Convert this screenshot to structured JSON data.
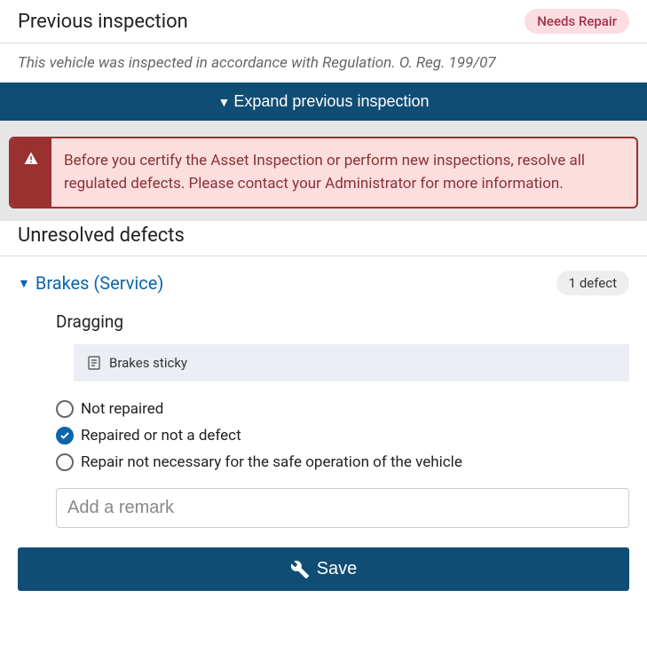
{
  "previous_inspection": {
    "title": "Previous inspection",
    "status_badge": "Needs Repair",
    "compliance_statement": "This vehicle was inspected in accordance with Regulation. O. Reg. 199/07",
    "expand_label": "Expand previous inspection"
  },
  "alert": {
    "message": "Before you certify the Asset Inspection or perform new inspections, resolve all regulated defects. Please contact your Administrator for more information."
  },
  "unresolved_defects": {
    "title": "Unresolved defects",
    "categories": [
      {
        "name": "Brakes (Service)",
        "count_label": "1 defect",
        "items": [
          {
            "title": "Dragging",
            "note": "Brakes sticky",
            "options": [
              {
                "label": "Not repaired",
                "selected": false
              },
              {
                "label": "Repaired or not a defect",
                "selected": true
              },
              {
                "label": "Repair not necessary for the safe operation of the vehicle",
                "selected": false
              }
            ],
            "remark_placeholder": "Add a remark"
          }
        ]
      }
    ]
  },
  "actions": {
    "save_label": "Save"
  }
}
